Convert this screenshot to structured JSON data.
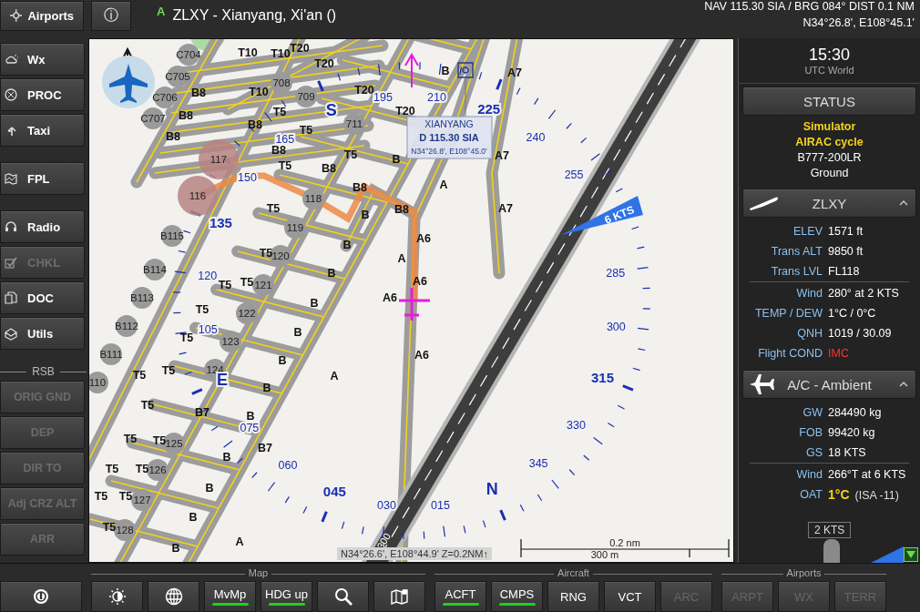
{
  "top_bar": {
    "airports_button": "Airports",
    "info_button": "ⓘ",
    "airport_class": "A",
    "title": "ZLXY - Xianyang, Xi'an ()",
    "nav_line": "NAV 115.30 SIA / BRG 084°  DIST 0.1 NM",
    "position_line": "N34°26.8', E108°45.1'"
  },
  "sidebar": {
    "groups": [
      [
        {
          "label": "Wx",
          "disabled": false
        },
        {
          "label": "PROC",
          "disabled": false
        },
        {
          "label": "Taxi",
          "disabled": false
        }
      ],
      [
        {
          "label": "FPL",
          "disabled": false
        }
      ],
      [
        {
          "label": "Radio",
          "disabled": false
        },
        {
          "label": "CHKL",
          "disabled": true
        },
        {
          "label": "DOC",
          "disabled": false
        },
        {
          "label": "Utils",
          "disabled": false
        }
      ]
    ],
    "rsb": {
      "title": "RSB",
      "buttons": [
        {
          "label": "ORIG GND",
          "disabled": true
        },
        {
          "label": "DEP",
          "disabled": true
        },
        {
          "label": "DIR TO",
          "disabled": true
        },
        {
          "label": "Adj CRZ ALT",
          "disabled": true
        },
        {
          "label": "ARR",
          "disabled": true
        }
      ]
    }
  },
  "map": {
    "stands": [
      {
        "text": "C704",
        "kind": "gate"
      },
      {
        "text": "C705",
        "kind": "gate"
      },
      {
        "text": "C706",
        "kind": "gate"
      },
      {
        "text": "C707",
        "kind": "gate"
      },
      {
        "text": "708",
        "kind": "gate"
      },
      {
        "text": "709",
        "kind": "gate"
      },
      {
        "text": "711",
        "kind": "gate"
      },
      {
        "text": "117",
        "kind": "marked"
      },
      {
        "text": "116",
        "kind": "marked"
      },
      {
        "text": "118",
        "kind": "gate"
      },
      {
        "text": "119",
        "kind": "gate"
      },
      {
        "text": "120",
        "kind": "gate"
      },
      {
        "text": "121",
        "kind": "gate"
      },
      {
        "text": "122",
        "kind": "gate"
      },
      {
        "text": "123",
        "kind": "gate"
      },
      {
        "text": "124",
        "kind": "gate"
      },
      {
        "text": "125",
        "kind": "gate"
      },
      {
        "text": "126",
        "kind": "gate"
      },
      {
        "text": "127",
        "kind": "gate"
      },
      {
        "text": "128",
        "kind": "gate"
      },
      {
        "text": "B115",
        "kind": "gate"
      },
      {
        "text": "B114",
        "kind": "gate"
      },
      {
        "text": "B113",
        "kind": "gate"
      },
      {
        "text": "B112",
        "kind": "gate"
      },
      {
        "text": "B111",
        "kind": "gate"
      },
      {
        "text": "110",
        "kind": "gate"
      }
    ],
    "taxiway_labels": [
      "T10",
      "T10",
      "T20",
      "T20",
      "B8",
      "B8",
      "B8",
      "T10",
      "T5",
      "T5",
      "B8",
      "B8",
      "T20",
      "T20",
      "T5",
      "T5",
      "B8",
      "B",
      "B8",
      "B8",
      "B",
      "T5",
      "T5",
      "B",
      "T5",
      "B",
      "A",
      "A7",
      "A7",
      "A7",
      "B",
      "A6",
      "A6",
      "A",
      "A6",
      "A6",
      "T5",
      "T5",
      "T5",
      "T5",
      "T5",
      "T5",
      "B",
      "B",
      "B",
      "B",
      "A",
      "B7",
      "B7",
      "B",
      "B",
      "T5",
      "T5",
      "T5",
      "T5",
      "T5",
      "T5",
      "T5",
      "B",
      "B",
      "B",
      "A"
    ],
    "compass": [
      {
        "text": "195",
        "kind": "minor"
      },
      {
        "text": "210",
        "kind": "minor"
      },
      {
        "text": "225",
        "kind": "major"
      },
      {
        "text": "240",
        "kind": "minor"
      },
      {
        "text": "255",
        "kind": "minor"
      },
      {
        "text": "285",
        "kind": "minor"
      },
      {
        "text": "300",
        "kind": "minor"
      },
      {
        "text": "315",
        "kind": "major"
      },
      {
        "text": "330",
        "kind": "minor"
      },
      {
        "text": "345",
        "kind": "minor"
      },
      {
        "text": "N",
        "kind": "cardinal"
      },
      {
        "text": "015",
        "kind": "minor"
      },
      {
        "text": "030",
        "kind": "minor"
      },
      {
        "text": "045",
        "kind": "major"
      },
      {
        "text": "060",
        "kind": "minor"
      },
      {
        "text": "075",
        "kind": "minor"
      },
      {
        "text": "E",
        "kind": "cardinal"
      },
      {
        "text": "105",
        "kind": "minor"
      },
      {
        "text": "120",
        "kind": "minor"
      },
      {
        "text": "135",
        "kind": "major"
      },
      {
        "text": "150",
        "kind": "minor"
      },
      {
        "text": "165",
        "kind": "minor"
      },
      {
        "text": "S",
        "kind": "cardinal"
      }
    ],
    "runway_label": "300",
    "wind": "6 KTS",
    "navaid": {
      "name": "XIANYANG",
      "frequency": "D 115.30 SIA",
      "position": "N34°26.8', E108°45.0'"
    },
    "cursor_position": "N34°26.6', E108°44.9' Z=0.2NM↑",
    "scale": {
      "nautical": "0.2 nm",
      "metric": "300 m"
    }
  },
  "panel": {
    "time": "15:30",
    "zone": "UTC World",
    "status_button": "STATUS",
    "status_lines": [
      {
        "text": "Simulator",
        "highlight": true
      },
      {
        "text": "AIRAC cycle",
        "highlight": true
      },
      {
        "text": "B777-200LR",
        "highlight": false
      },
      {
        "text": "Ground",
        "highlight": false
      }
    ],
    "sections": [
      {
        "title": "ZLXY",
        "expanded": true,
        "groups": [
          [
            {
              "label": "ELEV",
              "value": "1571 ft",
              "kind": "normal"
            },
            {
              "label": "Trans ALT",
              "value": "9850 ft",
              "kind": "normal"
            },
            {
              "label": "Trans LVL",
              "value": "FL118",
              "kind": "normal"
            }
          ],
          [
            {
              "label": "Wind",
              "value": "280° at 2 KTS",
              "kind": "normal"
            },
            {
              "label": "TEMP / DEW",
              "value": "1°C  /  0°C",
              "kind": "normal"
            },
            {
              "label": "QNH",
              "value": "1019 / 30.09",
              "kind": "normal"
            },
            {
              "label": "Flight COND",
              "value": "IMC",
              "kind": "alert"
            }
          ]
        ]
      },
      {
        "title": "A/C - Ambient",
        "expanded": true,
        "groups": [
          [
            {
              "label": "GW",
              "value": "284490 kg",
              "kind": "normal"
            },
            {
              "label": "FOB",
              "value": "99420 kg",
              "kind": "normal"
            },
            {
              "label": "GS",
              "value": "18 KTS",
              "kind": "normal"
            }
          ],
          [
            {
              "label": "Wind",
              "value": "266°T at 6 KTS",
              "kind": "normal"
            },
            {
              "label": "OAT",
              "value": "1°C",
              "note": "(ISA -11)",
              "kind": "caution"
            }
          ]
        ]
      }
    ],
    "wind_speed": "2 KTS"
  },
  "bottom_bar": {
    "groups": [
      {
        "title": "Map",
        "buttons": [
          {
            "kind": "brightness",
            "active": false,
            "disabled": false
          },
          {
            "kind": "globe",
            "active": false,
            "disabled": false
          },
          {
            "label": "MvMp",
            "kind": "text",
            "active": true,
            "disabled": false
          },
          {
            "label": "HDG up",
            "kind": "text",
            "active": true,
            "disabled": false
          },
          {
            "kind": "search",
            "active": false,
            "disabled": false
          },
          {
            "kind": "map",
            "active": false,
            "disabled": false
          }
        ]
      },
      {
        "title": "Aircraft",
        "buttons": [
          {
            "label": "ACFT",
            "kind": "text",
            "active": true,
            "disabled": false
          },
          {
            "label": "CMPS",
            "kind": "text",
            "active": true,
            "disabled": false
          },
          {
            "label": "RNG",
            "kind": "text",
            "active": false,
            "disabled": false
          },
          {
            "label": "VCT",
            "kind": "text",
            "active": false,
            "disabled": false
          },
          {
            "label": "ARC",
            "kind": "text",
            "active": false,
            "disabled": true
          }
        ]
      },
      {
        "title": "Airports",
        "buttons": [
          {
            "label": "ARPT",
            "kind": "text",
            "active": false,
            "disabled": true
          },
          {
            "label": "WX",
            "kind": "text",
            "active": false,
            "disabled": true
          },
          {
            "label": "TERR",
            "kind": "text",
            "active": false,
            "disabled": true
          }
        ]
      }
    ]
  }
}
